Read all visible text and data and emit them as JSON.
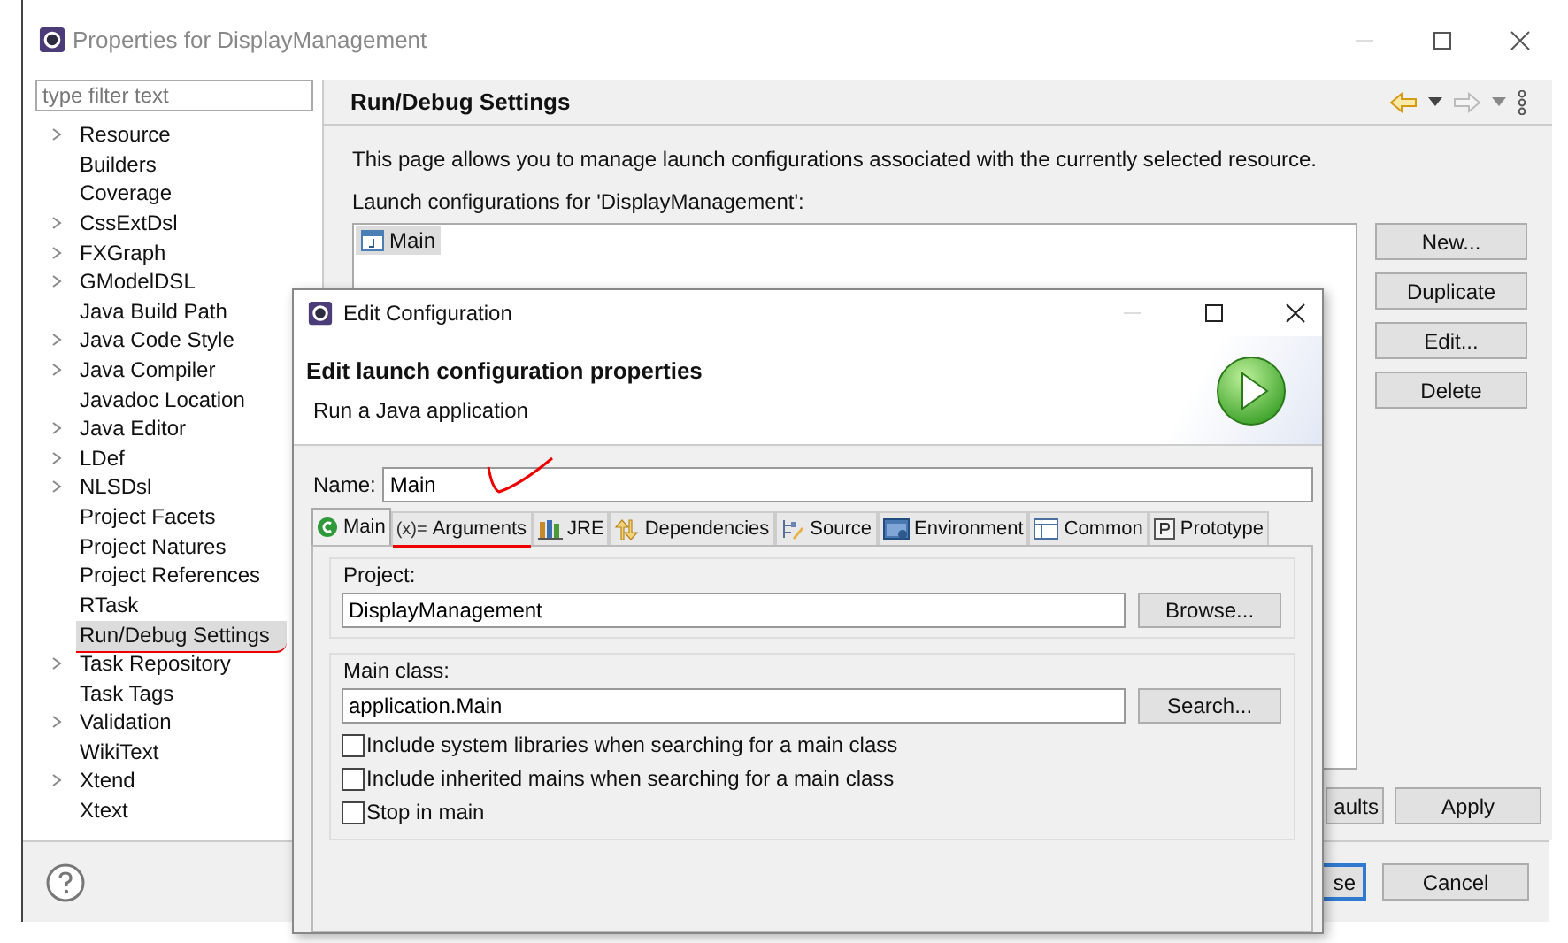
{
  "window": {
    "title": "Properties for DisplayManagement"
  },
  "sidebar": {
    "filter": {
      "placeholder": "type filter text"
    },
    "items": [
      {
        "label": "Resource",
        "expandable": true,
        "selected": false,
        "annotated": false
      },
      {
        "label": "Builders",
        "expandable": false,
        "selected": false,
        "annotated": false
      },
      {
        "label": "Coverage",
        "expandable": false,
        "selected": false,
        "annotated": false
      },
      {
        "label": "CssExtDsl",
        "expandable": true,
        "selected": false,
        "annotated": false
      },
      {
        "label": "FXGraph",
        "expandable": true,
        "selected": false,
        "annotated": false
      },
      {
        "label": "GModelDSL",
        "expandable": true,
        "selected": false,
        "annotated": false
      },
      {
        "label": "Java Build Path",
        "expandable": false,
        "selected": false,
        "annotated": false
      },
      {
        "label": "Java Code Style",
        "expandable": true,
        "selected": false,
        "annotated": false
      },
      {
        "label": "Java Compiler",
        "expandable": true,
        "selected": false,
        "annotated": false
      },
      {
        "label": "Javadoc Location",
        "expandable": false,
        "selected": false,
        "annotated": false
      },
      {
        "label": "Java Editor",
        "expandable": true,
        "selected": false,
        "annotated": false
      },
      {
        "label": "LDef",
        "expandable": true,
        "selected": false,
        "annotated": false
      },
      {
        "label": "NLSDsl",
        "expandable": true,
        "selected": false,
        "annotated": false
      },
      {
        "label": "Project Facets",
        "expandable": false,
        "selected": false,
        "annotated": false
      },
      {
        "label": "Project Natures",
        "expandable": false,
        "selected": false,
        "annotated": false
      },
      {
        "label": "Project References",
        "expandable": false,
        "selected": false,
        "annotated": false
      },
      {
        "label": "RTask",
        "expandable": false,
        "selected": false,
        "annotated": false
      },
      {
        "label": "Run/Debug Settings",
        "expandable": false,
        "selected": true,
        "annotated": true
      },
      {
        "label": "Task Repository",
        "expandable": true,
        "selected": false,
        "annotated": false
      },
      {
        "label": "Task Tags",
        "expandable": false,
        "selected": false,
        "annotated": false
      },
      {
        "label": "Validation",
        "expandable": true,
        "selected": false,
        "annotated": false
      },
      {
        "label": "WikiText",
        "expandable": false,
        "selected": false,
        "annotated": false
      },
      {
        "label": "Xtend",
        "expandable": true,
        "selected": false,
        "annotated": false
      },
      {
        "label": "Xtext",
        "expandable": false,
        "selected": false,
        "annotated": false
      }
    ]
  },
  "page": {
    "title": "Run/Debug Settings",
    "description": "This page allows you to manage launch configurations associated with the currently selected resource.",
    "list_label": "Launch configurations for 'DisplayManagement':",
    "configurations": [
      {
        "label": "Main",
        "selected": true
      }
    ],
    "buttons": [
      "New...",
      "Duplicate",
      "Edit...",
      "Delete"
    ],
    "bottom_buttons": [
      "aults",
      "Apply"
    ]
  },
  "footer_buttons": [
    {
      "label": "se",
      "focused": true
    },
    {
      "label": "Cancel",
      "focused": false
    }
  ],
  "dialog": {
    "title": "Edit Configuration",
    "heading": "Edit launch configuration properties",
    "subtitle": "Run a Java application",
    "name_label": "Name:",
    "name_value": "Main",
    "tabs": [
      {
        "label": "Main",
        "selected": true,
        "annotated": false
      },
      {
        "label": "Arguments",
        "prefix": "(x)=",
        "selected": false,
        "annotated": true
      },
      {
        "label": "JRE",
        "selected": false,
        "annotated": false
      },
      {
        "label": "Dependencies",
        "selected": false,
        "annotated": false
      },
      {
        "label": "Source",
        "selected": false,
        "annotated": false
      },
      {
        "label": "Environment",
        "selected": false,
        "annotated": false
      },
      {
        "label": "Common",
        "selected": false,
        "annotated": false
      },
      {
        "label": "Prototype",
        "selected": false,
        "annotated": false
      }
    ],
    "project": {
      "label": "Project:",
      "value": "DisplayManagement",
      "button": "Browse..."
    },
    "main_class": {
      "label": "Main class:",
      "value": "application.Main",
      "button": "Search..."
    },
    "options": [
      {
        "label": "Include system libraries when searching for a main class",
        "checked": false
      },
      {
        "label": "Include inherited mains when searching for a main class",
        "checked": false
      },
      {
        "label": "Stop in main",
        "checked": false
      }
    ]
  }
}
